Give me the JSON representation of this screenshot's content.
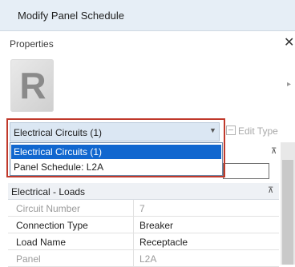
{
  "tab": {
    "title": "Modify Panel Schedule"
  },
  "properties": {
    "label": "Properties",
    "close_glyph": "✕"
  },
  "logo": {
    "letter": "R"
  },
  "type_selector": {
    "value": "Electrical Circuits (1)",
    "edit_type_label": "Edit Type",
    "options": [
      "Electrical Circuits (1)",
      "Panel Schedule: L2A"
    ]
  },
  "grid": {
    "group": "Electrical - Loads",
    "rows": [
      {
        "key": "Circuit Number",
        "value": "7",
        "readonly": true
      },
      {
        "key": "Connection Type",
        "value": "Breaker",
        "readonly": false
      },
      {
        "key": "Load Name",
        "value": "Receptacle",
        "readonly": false
      },
      {
        "key": "Panel",
        "value": "L2A",
        "readonly": true
      }
    ]
  },
  "colors": {
    "selection": "#1167cf",
    "highlight_border": "#c0392b",
    "header_bg": "#e6eef6"
  }
}
